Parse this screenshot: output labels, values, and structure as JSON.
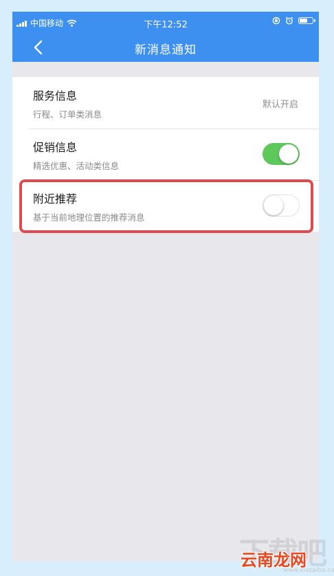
{
  "status_bar": {
    "carrier": "中国移动",
    "time": "下午12:52",
    "battery_level": 0.7
  },
  "nav": {
    "title": "新消息通知",
    "back_icon": "chevron-left-icon"
  },
  "settings": [
    {
      "title": "服务信息",
      "subtitle": "行程、订单类消息",
      "value": "默认开启"
    },
    {
      "title": "促销信息",
      "subtitle": "精选优惠、活动类信息",
      "toggle_on": true
    },
    {
      "title": "附近推荐",
      "subtitle": "基于当前地理位置的推荐消息",
      "toggle_on": false
    }
  ],
  "watermark": {
    "big": "下载吧",
    "brand": "云南龙网",
    "url": "www.xiazaiba.com"
  },
  "colors": {
    "accent": "#3d8ff0",
    "toggle_on": "#5fc85d",
    "highlight": "#e04a4e"
  }
}
